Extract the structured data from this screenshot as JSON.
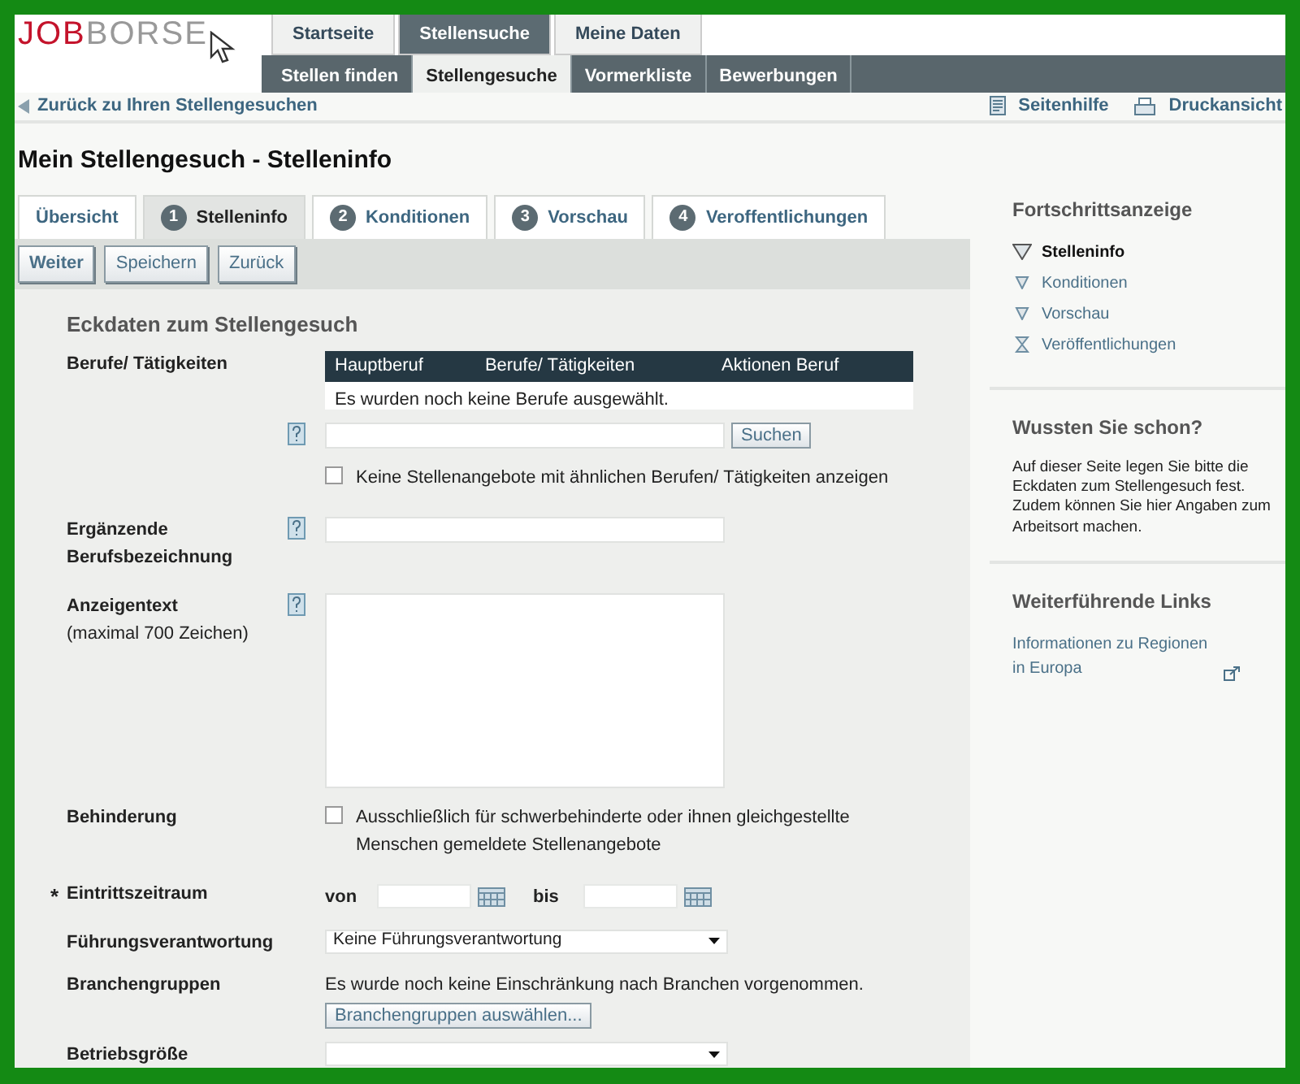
{
  "logo": {
    "text": "JOBBORSE"
  },
  "main_nav": [
    {
      "label": "Startseite",
      "selected": false
    },
    {
      "label": "Stellensuche",
      "selected": true
    },
    {
      "label": "Meine Daten",
      "selected": false
    }
  ],
  "sub_nav": [
    {
      "label": "Stellen finden",
      "selected": false
    },
    {
      "label": "Stellengesuche",
      "selected": true
    },
    {
      "label": "Vormerkliste",
      "selected": false
    },
    {
      "label": "Bewerbungen",
      "selected": false
    }
  ],
  "back_link": "Zurück zu Ihren Stellengesuchen",
  "toolbar_links": [
    {
      "label": "Seitenhilfe",
      "kind": "help"
    },
    {
      "label": "Druckansicht",
      "kind": "print"
    }
  ],
  "page_title": "Mein Stellengesuch - Stelleninfo",
  "steps": [
    {
      "label": "Übersicht",
      "selected": false
    },
    {
      "number": "1",
      "label": "Stelleninfo",
      "selected": true
    },
    {
      "number": "2",
      "label": "Konditionen",
      "selected": false
    },
    {
      "number": "3",
      "label": "Vorschau",
      "selected": false
    },
    {
      "number": "4",
      "label": "Veroffentlichungen",
      "selected": false
    }
  ],
  "action_buttons": [
    {
      "label": "Weiter",
      "primary": true
    },
    {
      "label": "Speichern",
      "primary": false
    },
    {
      "label": "Zurück",
      "primary": false
    }
  ],
  "form": {
    "heading": "Eckdaten zum Stellengesuch",
    "berufe": {
      "label": "Berufe/ Tätigkeiten",
      "columns": [
        "Hauptberuf",
        "Berufe/ Tätigkeiten",
        "Aktionen Beruf"
      ],
      "empty_text": "Es wurden noch keine Berufe ausgewählt.",
      "search_button": "Suchen",
      "similar_checkbox": {
        "label": "Keine Stellenangebote mit ähnlichen Berufen/ Tätigkeiten anzeigen",
        "checked": false
      }
    },
    "ergaenzende": {
      "label": "Ergänzende Berufsbezeichnung"
    },
    "anzeigentext": {
      "label": "Anzeigentext",
      "hint": "(maximal 700 Zeichen)"
    },
    "behinderung": {
      "label": "Behinderung",
      "checkbox": {
        "label": "Ausschließlich für schwerbehinderte oder ihnen gleichgestellte Menschen gemeldete Stellenangebote",
        "checked": false
      }
    },
    "eintritt": {
      "label": "Eintrittszeitraum",
      "required": true,
      "required_mark": "*",
      "from_label": "von",
      "to_label": "bis"
    },
    "fuehrung": {
      "label": "Führungsverantwortung",
      "value": "Keine Führungsverantwortung"
    },
    "branchen": {
      "label": "Branchengruppen",
      "note": "Es wurde noch keine Einschränkung nach Branchen vorgenommen.",
      "button": "Branchengruppen auswählen..."
    },
    "betriebsgroesse": {
      "label": "Betriebsgröße"
    }
  },
  "sidebar": {
    "progress": {
      "title": "Fortschrittsanzeige",
      "steps": [
        {
          "label": "Stelleninfo",
          "current": true,
          "kind": "funnel"
        },
        {
          "label": "Konditionen",
          "current": false,
          "kind": "funnel"
        },
        {
          "label": "Vorschau",
          "current": false,
          "kind": "funnel"
        },
        {
          "label": "Veröffentlichungen",
          "current": false,
          "kind": "hourglass"
        }
      ]
    },
    "tips": {
      "title": "Wussten Sie schon?",
      "text": "Auf dieser Seite legen Sie bitte die Eckdaten zum Stellengesuch fest. Zudem können Sie hier Angaben zum Arbeitsort machen."
    },
    "links": {
      "title": "Weiterführende Links",
      "items": [
        "Informationen zu Regionen in Europa"
      ]
    }
  }
}
